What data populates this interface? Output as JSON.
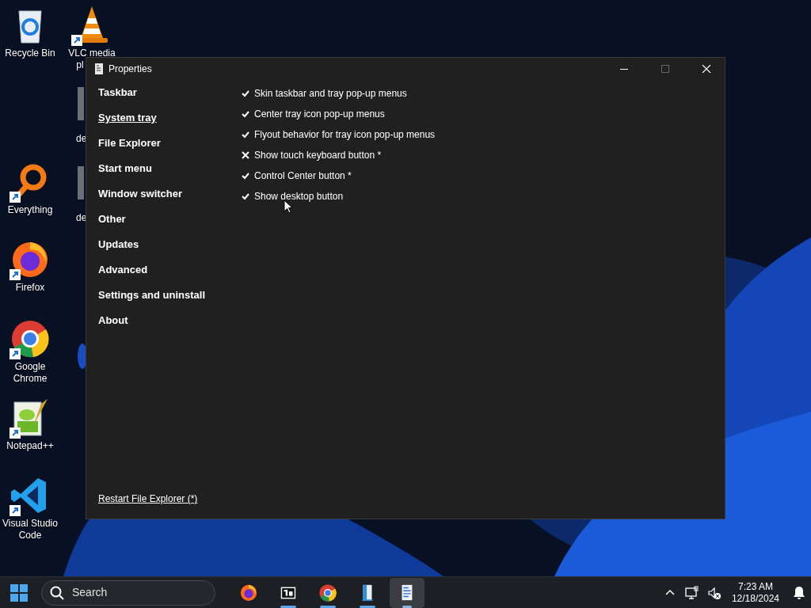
{
  "desktop_icons": [
    {
      "kind": "recycle",
      "label": "Recycle Bin",
      "shortcut": false
    },
    {
      "kind": "vlc",
      "label": "VLC media",
      "label_cut": "pl",
      "shortcut": true
    },
    {
      "kind": "doc",
      "label_cut": "de",
      "shortcut": false
    },
    {
      "kind": "doc",
      "label_cut": "de",
      "shortcut": false
    },
    {
      "kind": "everything",
      "label": "Everything",
      "shortcut": true
    },
    {
      "kind": "firefox",
      "label": "Firefox",
      "shortcut": true
    },
    {
      "kind": "chrome",
      "label": "Google Chrome",
      "shortcut": true
    },
    {
      "kind": "notepadpp",
      "label": "Notepad++",
      "shortcut": true
    },
    {
      "kind": "vscode",
      "label": "Visual Studio Code",
      "shortcut": true
    }
  ],
  "window": {
    "title": "Properties",
    "nav": [
      {
        "label": "Taskbar",
        "selected": false
      },
      {
        "label": "System tray",
        "selected": true
      },
      {
        "label": "File Explorer",
        "selected": false
      },
      {
        "label": "Start menu",
        "selected": false
      },
      {
        "label": "Window switcher",
        "selected": false
      },
      {
        "label": "Other",
        "selected": false
      },
      {
        "label": "Updates",
        "selected": false
      },
      {
        "label": "Advanced",
        "selected": false
      },
      {
        "label": "Settings and uninstall",
        "selected": false
      },
      {
        "label": "About",
        "selected": false
      }
    ],
    "options": [
      {
        "label": "Skin taskbar and tray pop-up menus",
        "checked": true
      },
      {
        "label": "Center tray icon pop-up menus",
        "checked": true
      },
      {
        "label": "Flyout behavior for tray icon pop-up menus",
        "checked": true
      },
      {
        "label": "Show touch keyboard button *",
        "checked": false
      },
      {
        "label": "Control Center button *",
        "checked": true
      },
      {
        "label": "Show desktop button",
        "checked": true
      }
    ],
    "footer_link": "Restart File Explorer (*)"
  },
  "taskbar": {
    "search": {
      "placeholder": "Search"
    },
    "apps": [
      {
        "kind": "firefox",
        "running": false,
        "selected": false
      },
      {
        "kind": "sevenzip",
        "running": true,
        "selected": false
      },
      {
        "kind": "chrome",
        "running": true,
        "selected": false
      },
      {
        "kind": "explorer",
        "running": true,
        "selected": false
      },
      {
        "kind": "properties",
        "running": true,
        "selected": true
      }
    ],
    "time": "7:23 AM",
    "date": "12/18/2024"
  }
}
